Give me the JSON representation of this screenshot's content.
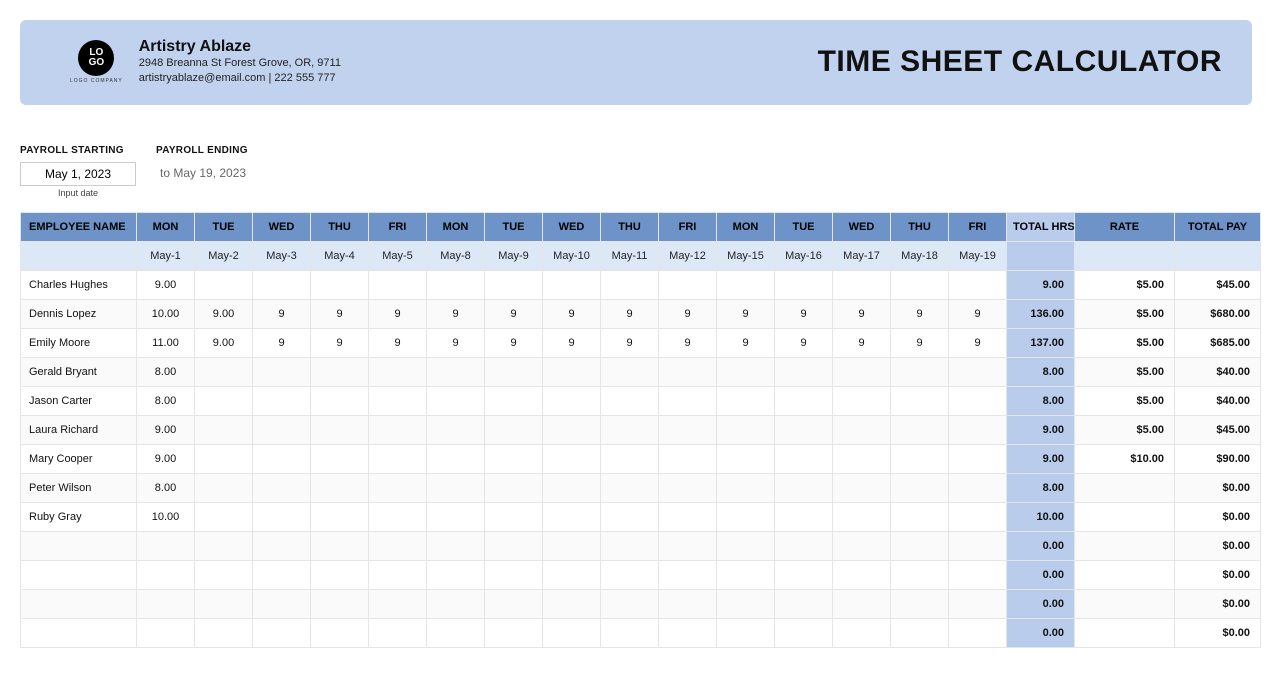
{
  "banner": {
    "company_name": "Artistry Ablaze",
    "address": "2948 Breanna St Forest Grove, OR, 9711",
    "contact": "artistryablaze@email.com | 222 555 777",
    "logo_top": "LO",
    "logo_bottom": "GO",
    "logo_caption": "LOGO COMPANY",
    "title": "TIME SHEET CALCULATOR"
  },
  "payroll": {
    "starting_label": "PAYROLL STARTING",
    "ending_label": "PAYROLL ENDING",
    "starting_value": "May 1, 2023",
    "ending_text": "to May 19, 2023",
    "hint": "Input date"
  },
  "columns": {
    "name": "EMPLOYEE NAME",
    "dow": [
      "MON",
      "TUE",
      "WED",
      "THU",
      "FRI",
      "MON",
      "TUE",
      "WED",
      "THU",
      "FRI",
      "MON",
      "TUE",
      "WED",
      "THU",
      "FRI"
    ],
    "dates": [
      "May-1",
      "May-2",
      "May-3",
      "May-4",
      "May-5",
      "May-8",
      "May-9",
      "May-10",
      "May-11",
      "May-12",
      "May-15",
      "May-16",
      "May-17",
      "May-18",
      "May-19"
    ],
    "total": "TOTAL HRS",
    "rate": "RATE",
    "pay": "TOTAL PAY"
  },
  "rows": [
    {
      "name": "Charles Hughes",
      "h": [
        "9.00",
        "",
        "",
        "",
        "",
        "",
        "",
        "",
        "",
        "",
        "",
        "",
        "",
        "",
        ""
      ],
      "total": "9.00",
      "rate": "$5.00",
      "pay": "$45.00"
    },
    {
      "name": "Dennis Lopez",
      "h": [
        "10.00",
        "9.00",
        "9",
        "9",
        "9",
        "9",
        "9",
        "9",
        "9",
        "9",
        "9",
        "9",
        "9",
        "9",
        "9"
      ],
      "total": "136.00",
      "rate": "$5.00",
      "pay": "$680.00"
    },
    {
      "name": "Emily Moore",
      "h": [
        "11.00",
        "9.00",
        "9",
        "9",
        "9",
        "9",
        "9",
        "9",
        "9",
        "9",
        "9",
        "9",
        "9",
        "9",
        "9"
      ],
      "total": "137.00",
      "rate": "$5.00",
      "pay": "$685.00"
    },
    {
      "name": "Gerald Bryant",
      "h": [
        "8.00",
        "",
        "",
        "",
        "",
        "",
        "",
        "",
        "",
        "",
        "",
        "",
        "",
        "",
        ""
      ],
      "total": "8.00",
      "rate": "$5.00",
      "pay": "$40.00"
    },
    {
      "name": "Jason Carter",
      "h": [
        "8.00",
        "",
        "",
        "",
        "",
        "",
        "",
        "",
        "",
        "",
        "",
        "",
        "",
        "",
        ""
      ],
      "total": "8.00",
      "rate": "$5.00",
      "pay": "$40.00"
    },
    {
      "name": "Laura Richard",
      "h": [
        "9.00",
        "",
        "",
        "",
        "",
        "",
        "",
        "",
        "",
        "",
        "",
        "",
        "",
        "",
        ""
      ],
      "total": "9.00",
      "rate": "$5.00",
      "pay": "$45.00"
    },
    {
      "name": "Mary Cooper",
      "h": [
        "9.00",
        "",
        "",
        "",
        "",
        "",
        "",
        "",
        "",
        "",
        "",
        "",
        "",
        "",
        ""
      ],
      "total": "9.00",
      "rate": "$10.00",
      "pay": "$90.00"
    },
    {
      "name": "Peter Wilson",
      "h": [
        "8.00",
        "",
        "",
        "",
        "",
        "",
        "",
        "",
        "",
        "",
        "",
        "",
        "",
        "",
        ""
      ],
      "total": "8.00",
      "rate": "",
      "pay": "$0.00"
    },
    {
      "name": "Ruby  Gray",
      "h": [
        "10.00",
        "",
        "",
        "",
        "",
        "",
        "",
        "",
        "",
        "",
        "",
        "",
        "",
        "",
        ""
      ],
      "total": "10.00",
      "rate": "",
      "pay": "$0.00"
    },
    {
      "name": "",
      "h": [
        "",
        "",
        "",
        "",
        "",
        "",
        "",
        "",
        "",
        "",
        "",
        "",
        "",
        "",
        ""
      ],
      "total": "0.00",
      "rate": "",
      "pay": "$0.00"
    },
    {
      "name": "",
      "h": [
        "",
        "",
        "",
        "",
        "",
        "",
        "",
        "",
        "",
        "",
        "",
        "",
        "",
        "",
        ""
      ],
      "total": "0.00",
      "rate": "",
      "pay": "$0.00"
    },
    {
      "name": "",
      "h": [
        "",
        "",
        "",
        "",
        "",
        "",
        "",
        "",
        "",
        "",
        "",
        "",
        "",
        "",
        ""
      ],
      "total": "0.00",
      "rate": "",
      "pay": "$0.00"
    },
    {
      "name": "",
      "h": [
        "",
        "",
        "",
        "",
        "",
        "",
        "",
        "",
        "",
        "",
        "",
        "",
        "",
        "",
        ""
      ],
      "total": "0.00",
      "rate": "",
      "pay": "$0.00"
    }
  ]
}
